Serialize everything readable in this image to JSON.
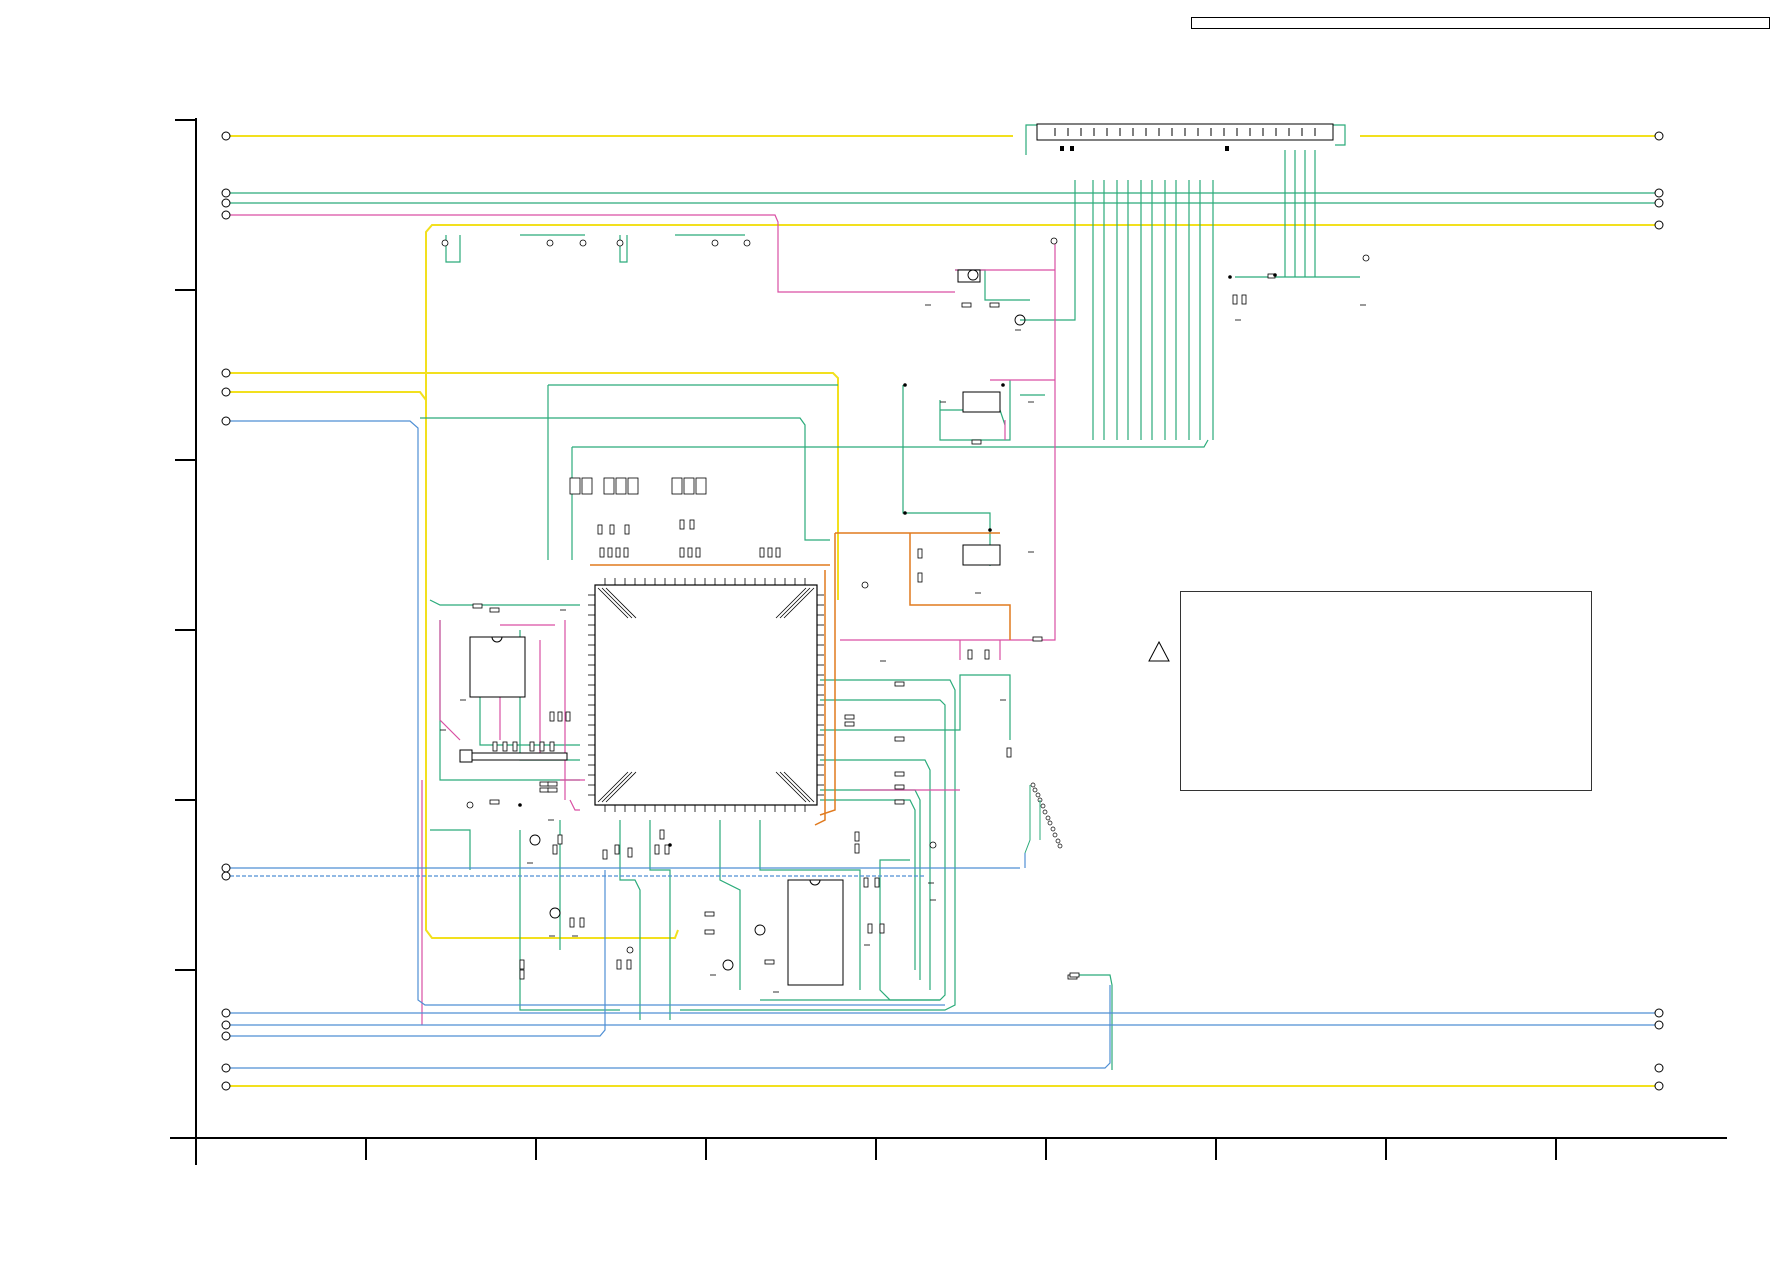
{
  "header": {
    "title": ""
  },
  "notes": {
    "text": ""
  },
  "colors": {
    "power_net": "#f2e01e",
    "signal_net": "#2bab7a",
    "control_net": "#d94fa3",
    "data_net": "#4f8fd4",
    "reset_net": "#e07a1f",
    "frame": "#000000"
  },
  "icons": [
    "warning-triangle-icon"
  ]
}
